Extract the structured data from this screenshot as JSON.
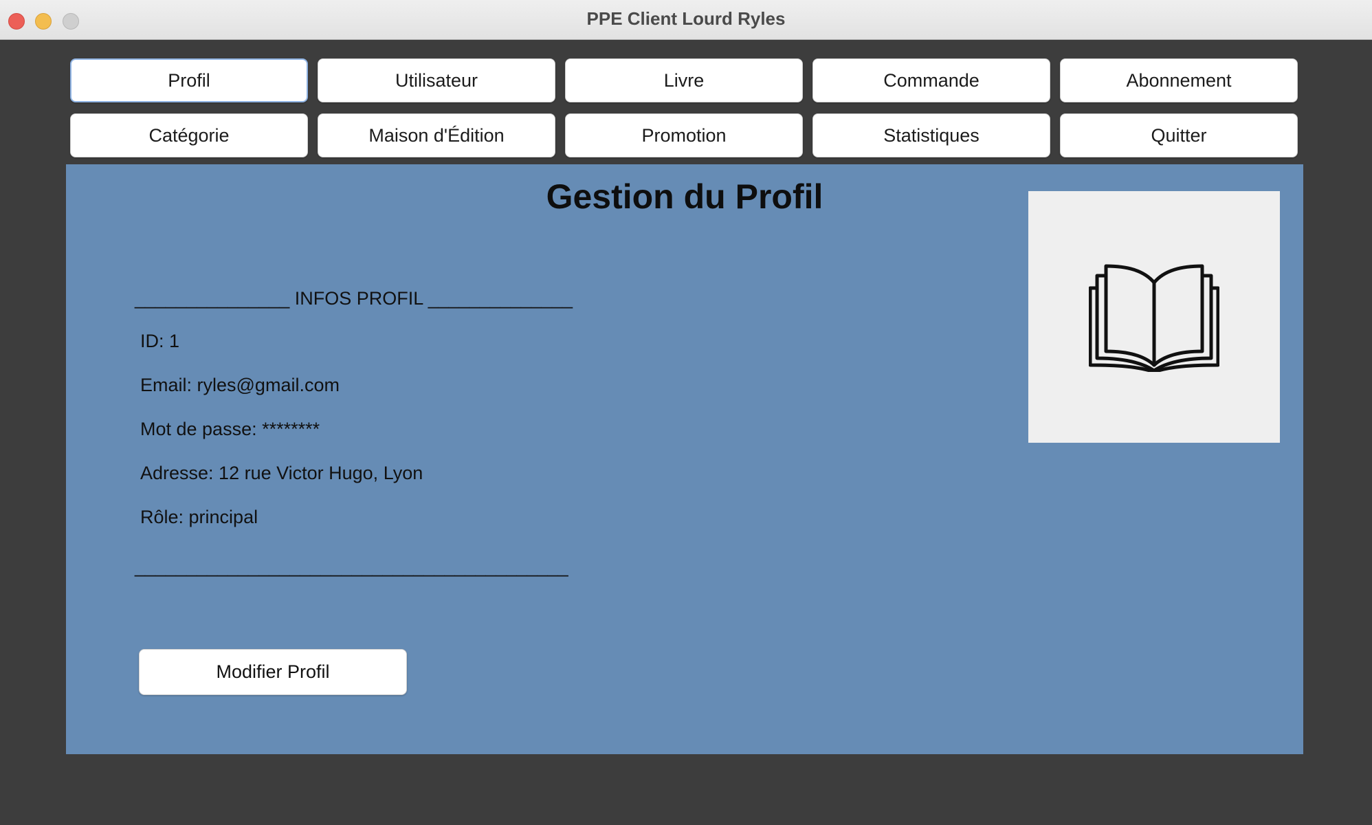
{
  "window": {
    "title": "PPE Client Lourd Ryles"
  },
  "nav": {
    "row1": [
      "Profil",
      "Utilisateur",
      "Livre",
      "Commande",
      "Abonnement"
    ],
    "row2": [
      "Catégorie",
      "Maison d'Édition",
      "Promotion",
      "Statistiques",
      "Quitter"
    ],
    "active": "Profil"
  },
  "panel": {
    "title": "Gestion du Profil",
    "header_line": "_______________ INFOS PROFIL ______________",
    "fields": [
      "ID: 1",
      "Email: ryles@gmail.com",
      "Mot de passe: ********",
      "Adresse: 12 rue Victor Hugo, Lyon",
      "Rôle: principal"
    ],
    "footer_line": "__________________________________________",
    "action_button": "Modifier Profil",
    "image_icon": "open-book-icon",
    "background_color": "#668cb5"
  }
}
